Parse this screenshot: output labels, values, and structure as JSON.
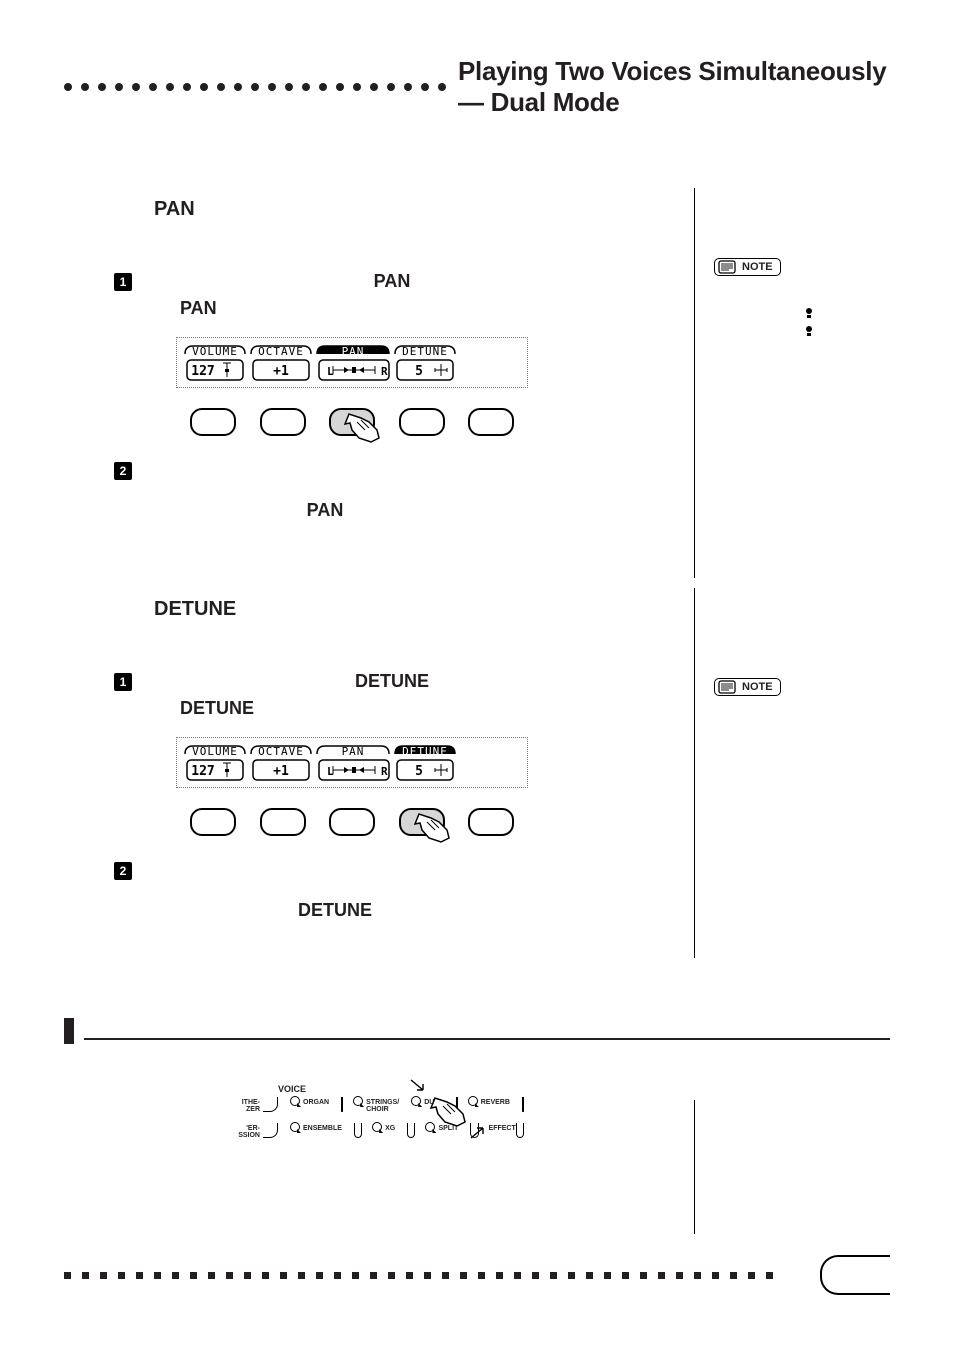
{
  "chapter_title": "Playing Two Voices Simultaneously — Dual Mode",
  "chart_data": [
    {
      "type": "table",
      "title": "LCD parameter strip (PAN step)",
      "categories": [
        "VOLUME",
        "OCTAVE",
        "PAN",
        "DETUNE"
      ],
      "values": [
        "127",
        "+1",
        "L◄●►R",
        "5"
      ],
      "highlighted": "PAN"
    },
    {
      "type": "table",
      "title": "LCD parameter strip (DETUNE step)",
      "categories": [
        "VOLUME",
        "OCTAVE",
        "PAN",
        "DETUNE"
      ],
      "values": [
        "127",
        "+1",
        "L◄●►R",
        "5"
      ],
      "highlighted": "DETUNE"
    }
  ],
  "sections": {
    "pan": {
      "heading": "PAN",
      "step1_lead": "PAN",
      "step1_sub": "PAN",
      "step2_label": "PAN",
      "lcd": {
        "items": [
          {
            "label": "VOLUME",
            "value": "127"
          },
          {
            "label": "OCTAVE",
            "value": "+1"
          },
          {
            "label": "PAN",
            "value": "L◄●►R",
            "highlight": true
          },
          {
            "label": "DETUNE",
            "value": "5"
          }
        ]
      }
    },
    "detune": {
      "heading": "DETUNE",
      "step1_lead": "DETUNE",
      "step1_sub": "DETUNE",
      "step2_label": "DETUNE",
      "lcd": {
        "items": [
          {
            "label": "VOLUME",
            "value": "127"
          },
          {
            "label": "OCTAVE",
            "value": "+1"
          },
          {
            "label": "PAN",
            "value": "L◄●►R"
          },
          {
            "label": "DETUNE",
            "value": "5",
            "highlight": true
          }
        ]
      }
    }
  },
  "note_label": "NOTE",
  "voice_panel": {
    "title": "VOICE",
    "row1": [
      "ITHE-\nZER",
      "ORGAN",
      "STRINGS/\nCHOIR",
      "DUAL",
      "REVERB"
    ],
    "row2": [
      "'ER-\nSSION",
      "ENSEMBLE",
      "XG",
      "SPLIT",
      "EFFECT"
    ]
  }
}
